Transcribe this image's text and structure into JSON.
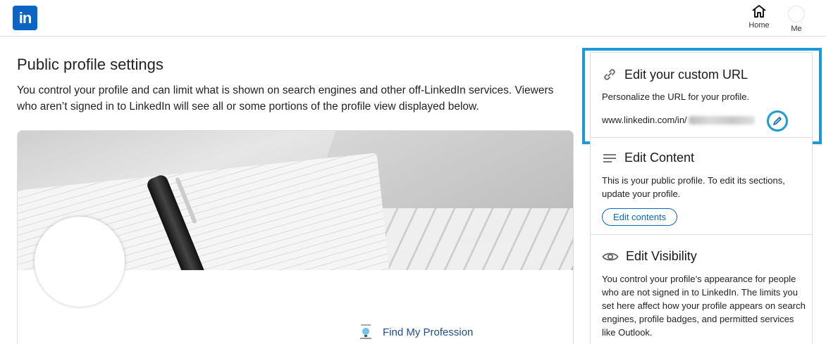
{
  "nav": {
    "logo_text": "in",
    "home_label": "Home",
    "me_label": "Me"
  },
  "main": {
    "title": "Public profile settings",
    "description": "You control your profile and can limit what is shown on search engines and other off-LinkedIn services. Viewers who aren’t signed in to LinkedIn will see all or some portions of the profile view displayed below.",
    "company_name": "Find My Profession"
  },
  "rail": {
    "custom_url": {
      "heading": "Edit your custom URL",
      "text": "Personalize the URL for your profile.",
      "url_prefix": "www.linkedin.com/in/"
    },
    "content": {
      "heading": "Edit Content",
      "text": "This is your public profile. To edit its sections, update your profile.",
      "button_label": "Edit contents"
    },
    "visibility": {
      "heading": "Edit Visibility",
      "text": "You control your profile’s appearance for people who are not signed in to LinkedIn. The limits you set here affect how your profile appears on search engines, profile badges, and permitted services like Outlook."
    }
  },
  "colors": {
    "brand": "#0a66c2",
    "highlight": "#1a9ad6"
  }
}
